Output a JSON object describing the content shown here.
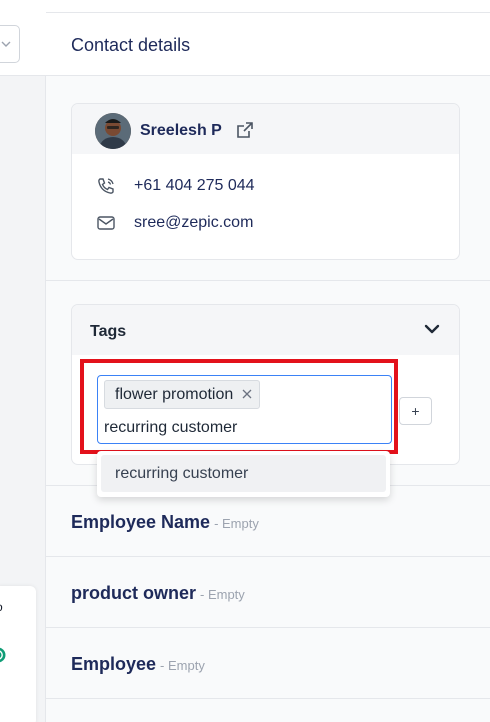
{
  "panel": {
    "title": "Contact details"
  },
  "contact": {
    "name": "Sreelesh P",
    "phone": "+61 404 275 044",
    "email": "sree@zepic.com"
  },
  "tags": {
    "title": "Tags",
    "selected": [
      "flower promotion"
    ],
    "input_value": "recurring customer",
    "suggestions": [
      "recurring customer"
    ],
    "add_label": "+"
  },
  "fields": [
    {
      "label": "Employee Name",
      "value": "- Empty"
    },
    {
      "label": "product owner",
      "value": "- Empty"
    },
    {
      "label": "Employee",
      "value": "- Empty"
    }
  ],
  "left_fragment": {
    "text": "o"
  },
  "colors": {
    "heading_navy": "#1e2a5a",
    "highlight_red": "#e3111b",
    "focus_blue": "#3b82f6",
    "status_green": "#0f9d76"
  }
}
